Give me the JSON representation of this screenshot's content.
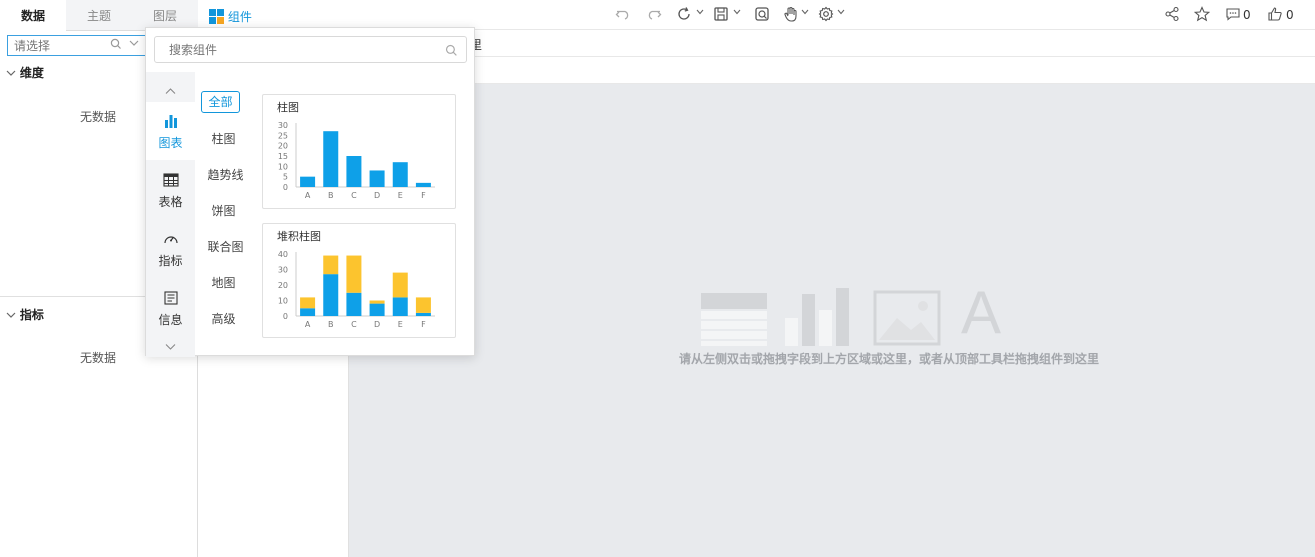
{
  "left_panel": {
    "tabs": [
      "数据",
      "主题",
      "图层"
    ],
    "search_placeholder": "请选择",
    "sections": [
      {
        "title": "维度",
        "empty_text": "无数据"
      },
      {
        "title": "指标",
        "empty_text": "无数据"
      }
    ]
  },
  "toolbar": {
    "component_label": "组件",
    "comment_count": "0",
    "like_count": "0"
  },
  "row2": {
    "partial_text": "里"
  },
  "canvas": {
    "hint": "请从左侧双击或拖拽字段到上方区域或这里，或者从顶部工具栏拖拽组件到这里",
    "placeholder_letter": "A"
  },
  "popup": {
    "search_placeholder": "搜索组件",
    "categories": [
      "图表",
      "表格",
      "指标",
      "信息"
    ],
    "subcategories": [
      "全部",
      "柱图",
      "趋势线",
      "饼图",
      "联合图",
      "地图",
      "高级"
    ],
    "cards": [
      {
        "title": "柱图"
      },
      {
        "title": "堆积柱图"
      }
    ]
  },
  "colors": {
    "accent": "#1296db",
    "bar_blue": "#0ea0e8",
    "bar_yellow": "#fcc42e"
  },
  "chart_data": [
    {
      "type": "bar",
      "title": "柱图",
      "categories": [
        "A",
        "B",
        "C",
        "D",
        "E",
        "F"
      ],
      "values": [
        5,
        27,
        15,
        8,
        12,
        2
      ],
      "ylim": [
        0,
        30
      ],
      "yticks": [
        "0",
        "5",
        "10",
        "15",
        "20",
        "25",
        "30"
      ]
    },
    {
      "type": "bar",
      "stacked": true,
      "title": "堆积柱图",
      "categories": [
        "A",
        "B",
        "C",
        "D",
        "E",
        "F"
      ],
      "series": [
        {
          "values": [
            5,
            27,
            15,
            8,
            12,
            2
          ],
          "color": "#0ea0e8"
        },
        {
          "values": [
            7,
            12,
            24,
            2,
            16,
            10
          ],
          "color": "#fcc42e"
        }
      ],
      "ylim": [
        0,
        40
      ],
      "yticks": [
        "0",
        "10",
        "20",
        "30",
        "40"
      ]
    }
  ]
}
